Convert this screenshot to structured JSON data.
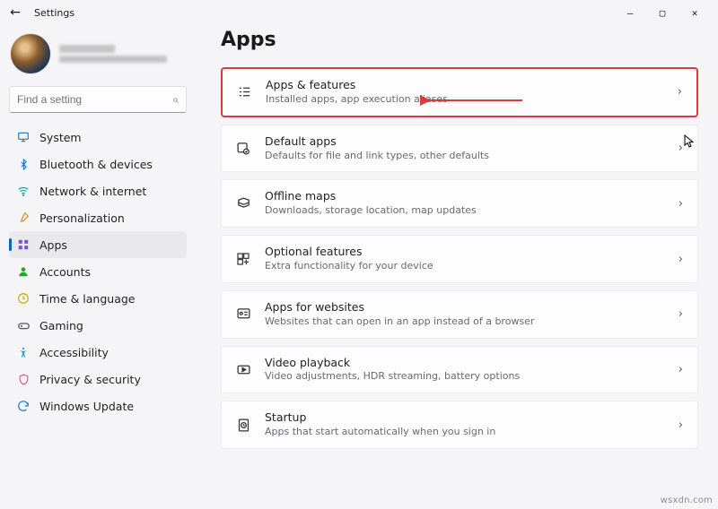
{
  "window": {
    "title": "Settings"
  },
  "search": {
    "placeholder": "Find a setting"
  },
  "page": {
    "title": "Apps"
  },
  "sidebar": {
    "items": [
      {
        "label": "System"
      },
      {
        "label": "Bluetooth & devices"
      },
      {
        "label": "Network & internet"
      },
      {
        "label": "Personalization"
      },
      {
        "label": "Apps"
      },
      {
        "label": "Accounts"
      },
      {
        "label": "Time & language"
      },
      {
        "label": "Gaming"
      },
      {
        "label": "Accessibility"
      },
      {
        "label": "Privacy & security"
      },
      {
        "label": "Windows Update"
      }
    ],
    "active_index": 4
  },
  "cards": [
    {
      "title": "Apps & features",
      "desc": "Installed apps, app execution aliases",
      "highlight": true
    },
    {
      "title": "Default apps",
      "desc": "Defaults for file and link types, other defaults"
    },
    {
      "title": "Offline maps",
      "desc": "Downloads, storage location, map updates"
    },
    {
      "title": "Optional features",
      "desc": "Extra functionality for your device"
    },
    {
      "title": "Apps for websites",
      "desc": "Websites that can open in an app instead of a browser"
    },
    {
      "title": "Video playback",
      "desc": "Video adjustments, HDR streaming, battery options"
    },
    {
      "title": "Startup",
      "desc": "Apps that start automatically when you sign in"
    }
  ],
  "watermark": "wsxdn.com"
}
